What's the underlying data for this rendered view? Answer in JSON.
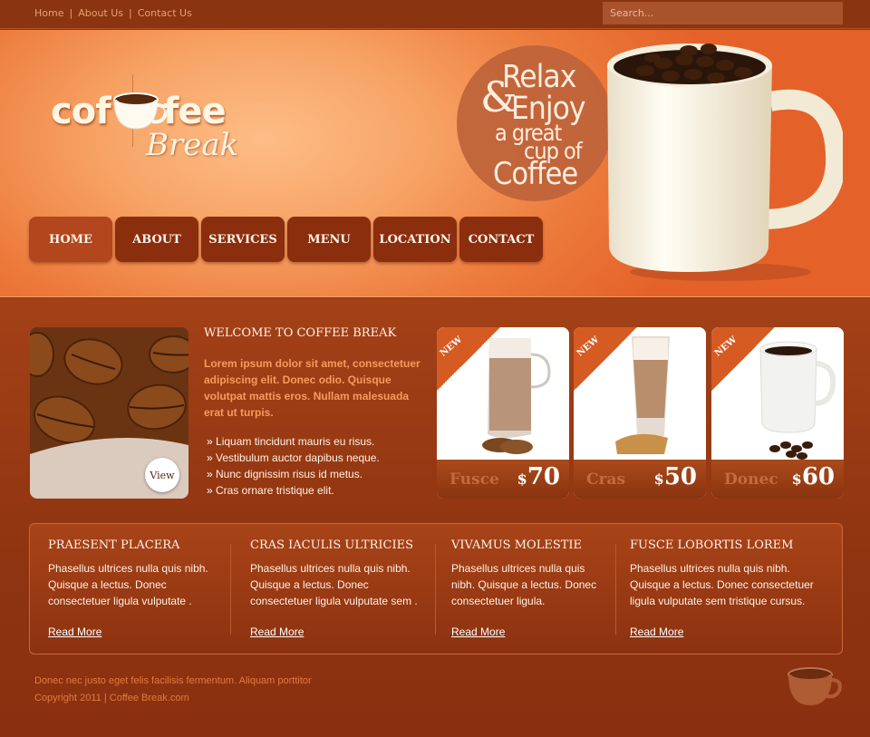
{
  "topbar": {
    "links": [
      "Home",
      "About Us",
      "Contact Us"
    ],
    "separator": "|",
    "search_placeholder": "Search..."
  },
  "logo": {
    "word_left": "cof",
    "word_right": "fee",
    "word_script": "Break"
  },
  "nav": {
    "items": [
      "HOME",
      "ABOUT",
      "SERVICES",
      "MENU",
      "LOCATION",
      "CONTACT"
    ]
  },
  "tagline": {
    "line1": "Relax",
    "amp": "&",
    "line2": "Enjoy",
    "line3": "a great",
    "line4": "cup of",
    "line5": "Coffee"
  },
  "welcome": {
    "view_label": "View",
    "title": "WELCOME TO COFFEE BREAK",
    "text": "Lorem ipsum dolor sit amet, consectetuer adipiscing elit. Donec odio. Quisque volutpat mattis eros. Nullam malesuada erat ut turpis.",
    "list": [
      "Liquam tincidunt mauris eu risus.",
      "Vestibulum auctor dapibus neque.",
      "Nunc dignissim risus id metus.",
      "Cras ornare tristique elit."
    ]
  },
  "products": [
    {
      "badge": "NEW",
      "name": "Fusce",
      "currency": "$",
      "price": "70"
    },
    {
      "badge": "NEW",
      "name": "Cras",
      "currency": "$",
      "price": "50"
    },
    {
      "badge": "NEW",
      "name": "Donec",
      "currency": "$",
      "price": "60"
    }
  ],
  "columns": [
    {
      "title": "PRAESENT PLACERA",
      "text": "Phasellus ultrices nulla quis nibh. Quisque a lectus. Donec consectetuer ligula vulputate .",
      "more": "Read More"
    },
    {
      "title": "CRAS IACULIS ULTRICIES",
      "text": "Phasellus ultrices nulla quis nibh. Quisque a lectus. Donec consectetuer ligula vulputate sem .",
      "more": "Read More"
    },
    {
      "title": "VIVAMUS MOLESTIE",
      "text": "Phasellus ultrices nulla quis nibh. Quisque a lectus. Donec consectetuer ligula.",
      "more": "Read More"
    },
    {
      "title": "FUSCE LOBORTIS LOREM",
      "text": "Phasellus ultrices nulla quis nibh. Quisque a lectus. Donec consectetuer ligula vulputate sem tristique cursus.",
      "more": "Read More"
    }
  ],
  "footer": {
    "line1": "Donec nec justo eget felis facilisis fermentum. Aliquam porttitor",
    "copyright": "Copyright 2011 | ",
    "site": "Coffee Break.com"
  },
  "colors": {
    "accent": "#ec7a3b",
    "nav_bg": "#8b2e0e",
    "nav_active": "#b2461c",
    "body_bg": "#8d3210",
    "highlight_text": "#f69a5d"
  },
  "icons": [
    "coffee-cup-icon",
    "coffee-mug-icon",
    "bullet-arrow-icon"
  ]
}
